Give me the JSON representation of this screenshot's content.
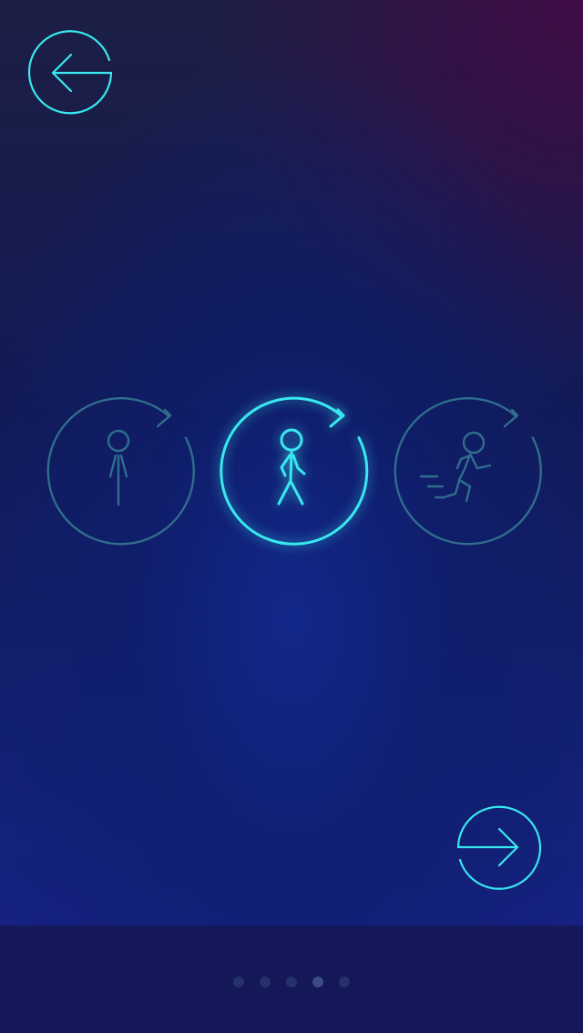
{
  "colors": {
    "accent": "#38e8ee",
    "inactive_outline": "#2f6e8c",
    "background_blue": "#14227a",
    "bottom_bar": "#141859",
    "pager_dot": "#25316a",
    "pager_dot_active": "#3c4a86"
  },
  "nav": {
    "back_icon": "arrow-left-circle-icon",
    "next_icon": "arrow-right-circle-icon"
  },
  "activities": [
    {
      "id": "standing",
      "icon": "standing-person-icon",
      "selected": false
    },
    {
      "id": "walking",
      "icon": "walking-person-icon",
      "selected": true
    },
    {
      "id": "running",
      "icon": "running-person-icon",
      "selected": false
    }
  ],
  "pager": {
    "total_pages": 5,
    "current_page": 4
  }
}
